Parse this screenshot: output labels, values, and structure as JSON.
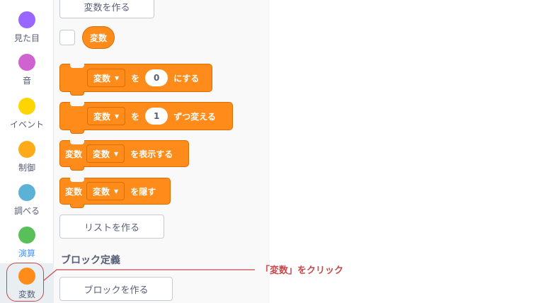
{
  "sidebar": {
    "categories": [
      {
        "label": "見た目",
        "color": "#9966ff"
      },
      {
        "label": "音",
        "color": "#cf63cf"
      },
      {
        "label": "イベント",
        "color": "#ffd500"
      },
      {
        "label": "制御",
        "color": "#ffab19"
      },
      {
        "label": "調べる",
        "color": "#5cb1d6"
      },
      {
        "label": "演算",
        "color": "#59c059"
      },
      {
        "label": "変数",
        "color": "#ff8c1a"
      }
    ]
  },
  "palette": {
    "make_variable_button": "変数を作る",
    "variable_reporter": "変数",
    "blocks": {
      "set": {
        "dropdown": "変数",
        "to": "を",
        "value": "0",
        "suffix": "にする"
      },
      "change": {
        "dropdown": "変数",
        "by": "を",
        "value": "1",
        "suffix": "ずつ変える"
      },
      "show": {
        "prefix": "変数",
        "dropdown": "変数",
        "suffix": "を表示する"
      },
      "hide": {
        "prefix": "変数",
        "dropdown": "変数",
        "suffix": "を隠す"
      }
    },
    "make_list_button": "リストを作る",
    "section_my_blocks": "ブロック定義",
    "make_block_button": "ブロックを作る"
  },
  "annotation": {
    "text": "「変数」をクリック",
    "color": "#c9484a"
  },
  "icons": {
    "dropdown": "▼"
  }
}
